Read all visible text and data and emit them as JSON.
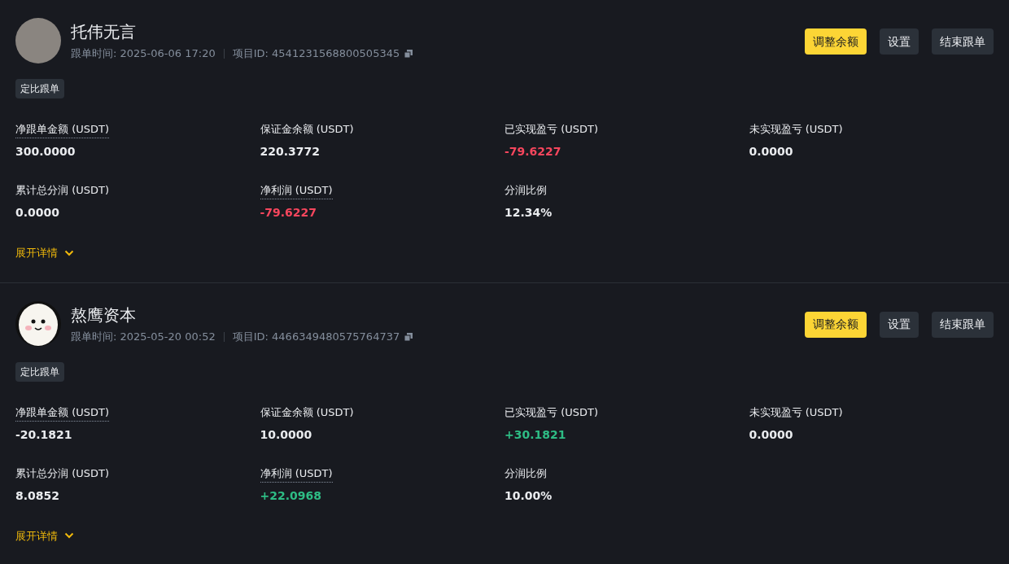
{
  "traders": [
    {
      "name": "托伟无言",
      "kind": "photo",
      "time_label": "跟单时间:",
      "time": "2025-06-06 17:20",
      "id_label": "项目ID:",
      "id": "4541231568800505345",
      "buttons": [
        {
          "label": "调整余额",
          "primary": true
        },
        {
          "label": "设置",
          "primary": false
        },
        {
          "label": "结束跟单",
          "primary": false
        }
      ],
      "tag": "定比跟单",
      "stats": [
        {
          "label": "净跟单金额 (USDT)",
          "tooltip": true,
          "value": "300.0000",
          "color": "#eaecef"
        },
        {
          "label": "保证金余额 (USDT)",
          "tooltip": false,
          "value": "220.3772",
          "color": "#eaecef"
        },
        {
          "label": "已实现盈亏 (USDT)",
          "tooltip": false,
          "value": "-79.6227",
          "color": "#f6465d"
        },
        {
          "label": "未实现盈亏 (USDT)",
          "tooltip": false,
          "value": "0.0000",
          "color": "#eaecef"
        },
        {
          "label": "累计总分润 (USDT)",
          "tooltip": false,
          "value": "0.0000",
          "color": "#eaecef"
        },
        {
          "label": "净利润 (USDT)",
          "tooltip": true,
          "value": "-79.6227",
          "color": "#f6465d"
        },
        {
          "label": "分润比例",
          "tooltip": false,
          "value": "12.34%",
          "color": "#eaecef"
        }
      ],
      "expand": "展开详情"
    },
    {
      "name": "熬鹰资本",
      "kind": "cartoon",
      "time_label": "跟单时间:",
      "time": "2025-05-20 00:52",
      "id_label": "项目ID:",
      "id": "4466349480575764737",
      "buttons": [
        {
          "label": "调整余额",
          "primary": true
        },
        {
          "label": "设置",
          "primary": false
        },
        {
          "label": "结束跟单",
          "primary": false
        }
      ],
      "tag": "定比跟单",
      "stats": [
        {
          "label": "净跟单金额 (USDT)",
          "tooltip": true,
          "value": "-20.1821",
          "color": "#eaecef"
        },
        {
          "label": "保证金余额 (USDT)",
          "tooltip": false,
          "value": "10.0000",
          "color": "#eaecef"
        },
        {
          "label": "已实现盈亏 (USDT)",
          "tooltip": false,
          "value": "+30.1821",
          "color": "#2ebd85"
        },
        {
          "label": "未实现盈亏 (USDT)",
          "tooltip": false,
          "value": "0.0000",
          "color": "#eaecef"
        },
        {
          "label": "累计总分润 (USDT)",
          "tooltip": false,
          "value": "8.0852",
          "color": "#eaecef"
        },
        {
          "label": "净利润 (USDT)",
          "tooltip": true,
          "value": "+22.0968",
          "color": "#2ebd85"
        },
        {
          "label": "分润比例",
          "tooltip": false,
          "value": "10.00%",
          "color": "#eaecef"
        }
      ],
      "expand": "展开详情"
    }
  ]
}
